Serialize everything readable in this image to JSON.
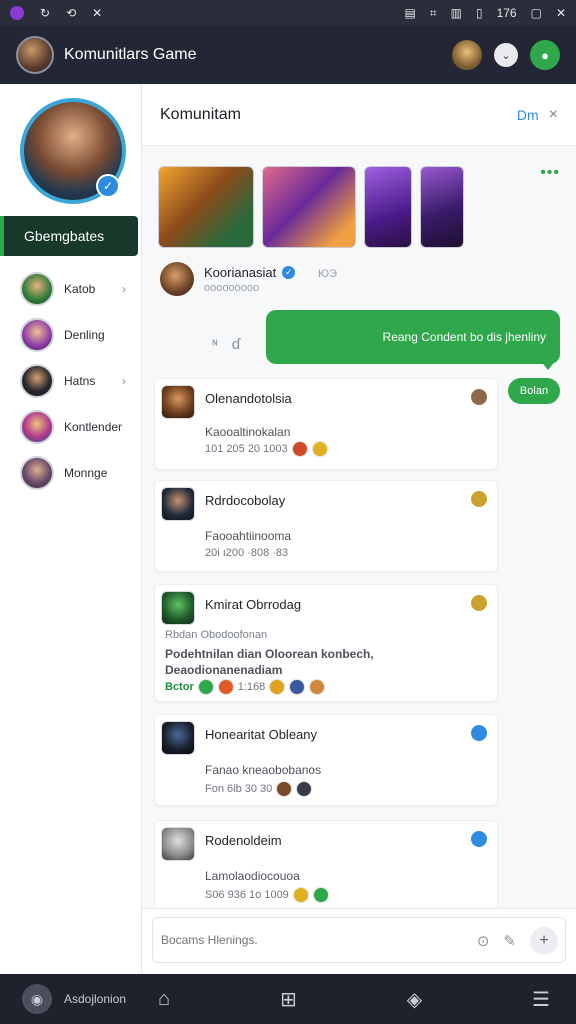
{
  "statusbar": {
    "left_icons": [
      "app-icon",
      "circle-arrow-icon",
      "refresh-icon",
      "close-icon"
    ],
    "right_icons": [
      "keyboard-icon",
      "hash-icon",
      "vibrate-icon",
      "battery-icon",
      "square-icon",
      "close-icon"
    ],
    "time": "176"
  },
  "appbar": {
    "title": "Komunitlars Game",
    "avatar_icon": "user-avatar",
    "right_icons": [
      "friend-avatar",
      "chevron-down-icon",
      "profile-icon"
    ]
  },
  "sidebar": {
    "profile_verified": "✓",
    "active_item": "Gbemgbates",
    "items": [
      {
        "label": "Katob",
        "chevron": "›"
      },
      {
        "label": "Denling",
        "chevron": ""
      },
      {
        "label": "Hatns",
        "chevron": "›"
      },
      {
        "label": "Kontlender",
        "chevron": ""
      },
      {
        "label": "Monnge",
        "chevron": ""
      }
    ]
  },
  "main": {
    "title": "Komunitam",
    "header_action": "Dm",
    "close_glyph": "×",
    "more_glyph": "•••",
    "post": {
      "author": "Koorianasiat",
      "author_extra": "ЮЭ",
      "meta": "ooooooooo",
      "verified": "✓"
    },
    "reactions": [
      "ᶰ",
      "ɗ"
    ],
    "bubble_text": "Reang Condent bo dis jhenliny",
    "reply_label": "Bolan",
    "cards": [
      {
        "title": "Olenandotolsia",
        "line1": "Kaooaltinokalan",
        "line2": "101 205 20 1003",
        "corner_color": "#8f6a4a"
      },
      {
        "title": "Rdrdocobolay",
        "line1": "Faooahtiinooma",
        "line2": "20i ı200 ·808 ·83",
        "corner_color": "#c9a230"
      },
      {
        "title": "Kmirat Obrrodag",
        "line1": "Rbdan Obodoofonan",
        "line2a": "Podehtnilan dian Oloorean konbech,",
        "line2b": "Deaodionanenadiam",
        "line3": "Bctor",
        "line3b": "1:168",
        "corner_color": "#c9a230"
      },
      {
        "title": "Honearitat Obleany",
        "line1": "Fanao kneaobobanos",
        "line2": "Fon 6ib 30 30",
        "corner_color": "#2f8be0"
      },
      {
        "title": "Rodenoldeim",
        "line1": "Lamolaodiocouoa",
        "line2": "S06 936 1o 1009",
        "corner_color": "#2f8be0"
      }
    ],
    "composer_placeholder": "Bocams Hlenings."
  },
  "bottombar": {
    "user_label": "Asdojlonion",
    "icons": [
      "home-icon",
      "grid-icon",
      "compass-icon",
      "menu-icon"
    ]
  },
  "colors": {
    "accent_green": "#2ea84a",
    "accent_blue": "#2f8be0",
    "dark_bar": "#232634"
  }
}
